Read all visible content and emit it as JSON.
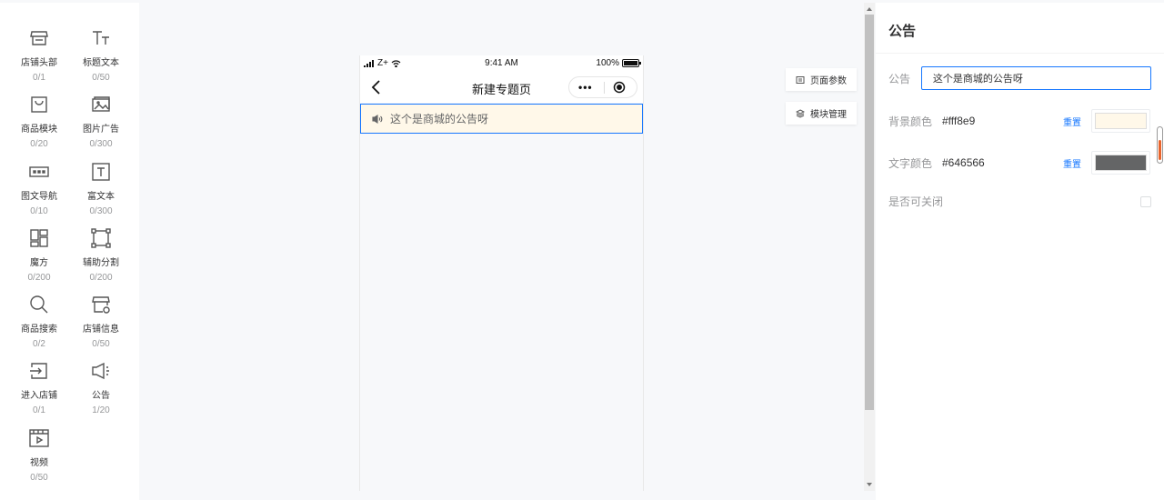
{
  "components": [
    {
      "name": "店铺头部",
      "count": "0/1",
      "icon": "store-header-icon"
    },
    {
      "name": "标题文本",
      "count": "0/50",
      "icon": "title-text-icon"
    },
    {
      "name": "商品模块",
      "count": "0/20",
      "icon": "shopping-bag-icon"
    },
    {
      "name": "图片广告",
      "count": "0/300",
      "icon": "image-ad-icon"
    },
    {
      "name": "图文导航",
      "count": "0/10",
      "icon": "image-nav-icon"
    },
    {
      "name": "富文本",
      "count": "0/300",
      "icon": "rich-text-icon"
    },
    {
      "name": "魔方",
      "count": "0/200",
      "icon": "cube-grid-icon"
    },
    {
      "name": "辅助分割",
      "count": "0/200",
      "icon": "divider-frame-icon"
    },
    {
      "name": "商品搜索",
      "count": "0/2",
      "icon": "search-icon"
    },
    {
      "name": "店铺信息",
      "count": "0/50",
      "icon": "store-info-icon"
    },
    {
      "name": "进入店铺",
      "count": "0/1",
      "icon": "enter-store-icon"
    },
    {
      "name": "公告",
      "count": "1/20",
      "icon": "megaphone-icon"
    },
    {
      "name": "视频",
      "count": "0/50",
      "icon": "video-icon"
    }
  ],
  "phone": {
    "status": {
      "carrier": "Z+",
      "time": "9:41 AM",
      "battery": "100%",
      "battery_level": 1.0
    },
    "nav_title": "新建专题页",
    "notice_text": "这个是商城的公告呀"
  },
  "tabs": [
    {
      "label": "页面参数",
      "icon": "page-settings-icon"
    },
    {
      "label": "模块管理",
      "icon": "layers-icon"
    }
  ],
  "panel": {
    "title": "公告",
    "notice_label": "公告",
    "notice_value": "这个是商城的公告呀",
    "bg_label": "背景颜色",
    "bg_value": "#fff8e9",
    "text_label": "文字颜色",
    "text_value": "#646566",
    "reset_label": "重置",
    "closable_label": "是否可关闭"
  },
  "colors": {
    "accent": "#1677ff",
    "notice_bg": "#fff8e9",
    "notice_text": "#646566"
  }
}
